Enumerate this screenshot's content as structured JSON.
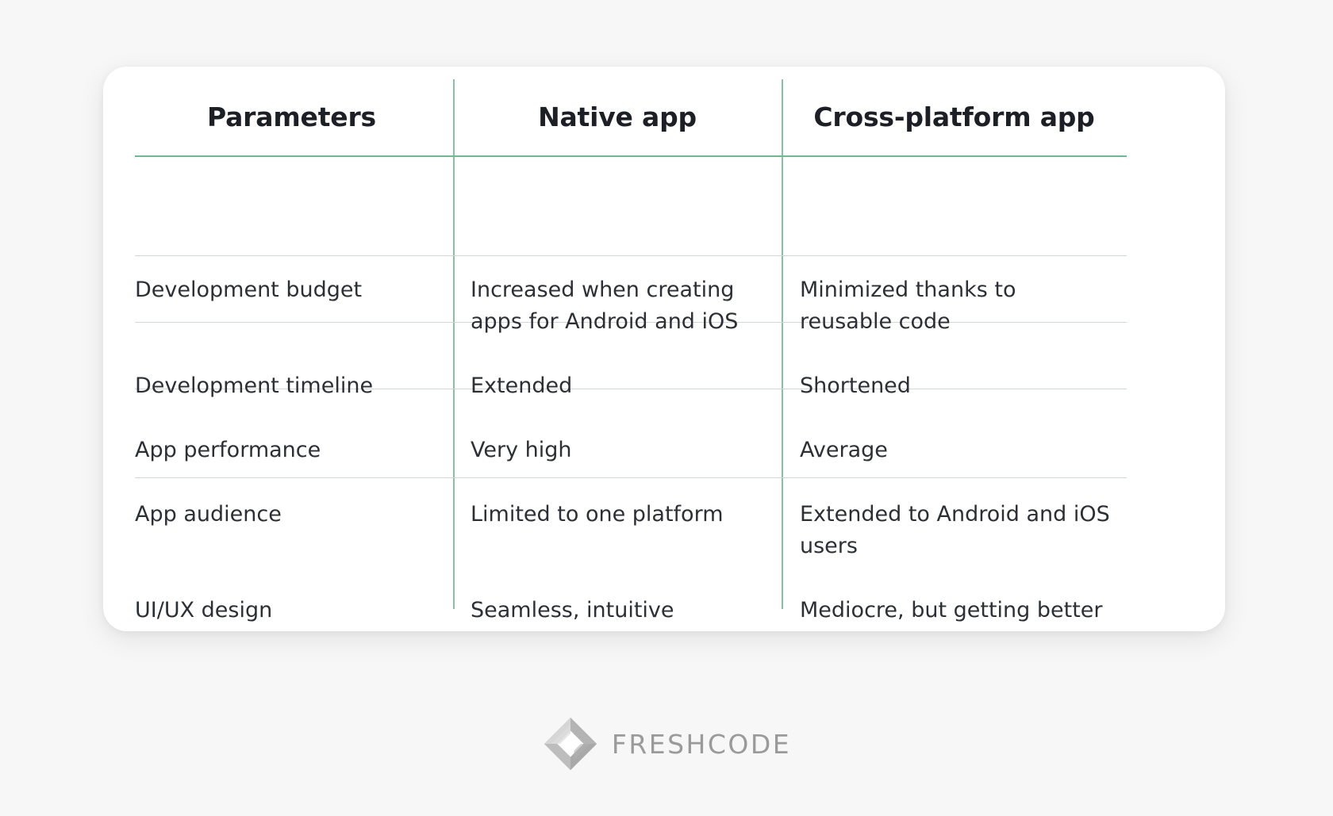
{
  "table": {
    "headers": [
      "Parameters",
      "Native app",
      "Cross-platform app"
    ],
    "rows": [
      {
        "parameter": "Development budget",
        "native": "Increased when creating apps for Android and iOS",
        "cross_platform": "Minimized thanks to reusable code"
      },
      {
        "parameter": "Development timeline",
        "native": "Extended",
        "cross_platform": "Shortened"
      },
      {
        "parameter": "App performance",
        "native": "Very high",
        "cross_platform": "Average"
      },
      {
        "parameter": "App audience",
        "native": "Limited to one platform",
        "cross_platform": "Extended to Android and iOS users"
      },
      {
        "parameter": "UI/UX design",
        "native": "Seamless, intuitive",
        "cross_platform": "Mediocre, but getting better"
      }
    ]
  },
  "branding": {
    "logo_icon": "freshcode-diamond-logo-icon",
    "logo_text": "FRESHCODE"
  },
  "colors": {
    "accent_green": "#6eb894",
    "row_divider": "#cfd9d4",
    "header_text": "#1c1f25",
    "body_text": "#2c3036",
    "logo_gray": "#9a9a9a",
    "page_background": "#f7f7f7",
    "card_background": "#ffffff"
  }
}
